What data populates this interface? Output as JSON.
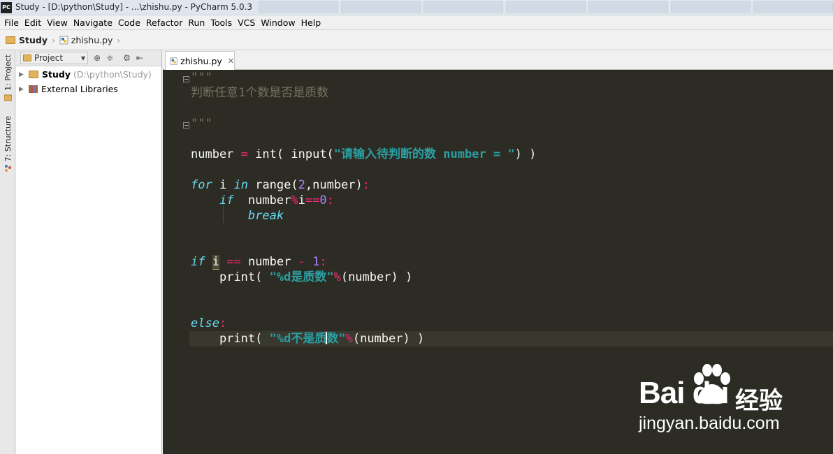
{
  "window": {
    "title": "Study - [D:\\python\\Study] - ...\\zhishu.py - PyCharm 5.0.3",
    "app_icon_text": "PC"
  },
  "menu": [
    "File",
    "Edit",
    "View",
    "Navigate",
    "Code",
    "Refactor",
    "Run",
    "Tools",
    "VCS",
    "Window",
    "Help"
  ],
  "breadcrumb": {
    "project": "Study",
    "file": "zhishu.py"
  },
  "left_strip": {
    "project_tab": "1: Project",
    "structure_tab": "7: Structure"
  },
  "project_panel": {
    "view_select": "Project",
    "tree": [
      {
        "label": "Study",
        "path": "(D:\\python\\Study)",
        "type": "folder"
      },
      {
        "label": "External Libraries",
        "type": "libraries"
      }
    ]
  },
  "editor": {
    "tab": "zhishu.py",
    "lines": {
      "doc_open": "\"\"\"",
      "doc_text": "判断任意1个数是否是质数",
      "doc_close": "\"\"\"",
      "l_number_a": "number",
      "l_number_eq": "=",
      "l_number_int": "int(",
      "l_number_input": "input(",
      "l_number_str": "\"请输入待判断的数 number = \"",
      "l_number_close": ") )",
      "for_kw": "for",
      "for_i": "i",
      "for_in": "in",
      "for_range": "range(",
      "for_two": "2",
      "for_rest": ",number)",
      "colon": ":",
      "if1_kw": "if",
      "if1_number": "number",
      "if1_mod": "%",
      "if1_i": "i",
      "if1_eq": "==",
      "if1_zero": "0",
      "break_kw": "break",
      "if2_kw": "if",
      "if2_i": "i",
      "if2_eq": "==",
      "if2_number": "number",
      "if2_minus": "-",
      "if2_one": "1",
      "print1_fn": "print(",
      "print1_str": "\"%d是质数\"",
      "print1_mod": "%",
      "print1_rest": "(number) )",
      "else_kw": "else",
      "print2_fn": "print(",
      "print2_str_a": "\"%d不是质",
      "print2_str_b": "数\"",
      "print2_mod": "%",
      "print2_rest": "(number) )"
    }
  },
  "watermark": {
    "logo": "Bai du",
    "cn": "经验",
    "url": "jingyan.baidu.com"
  },
  "colors": {
    "editor_bg": "#2c2c24",
    "keyword": "#66d9ef",
    "operator": "#f92672",
    "number": "#ae81ff",
    "string": "#2b9fa3",
    "comment": "#75715e"
  }
}
